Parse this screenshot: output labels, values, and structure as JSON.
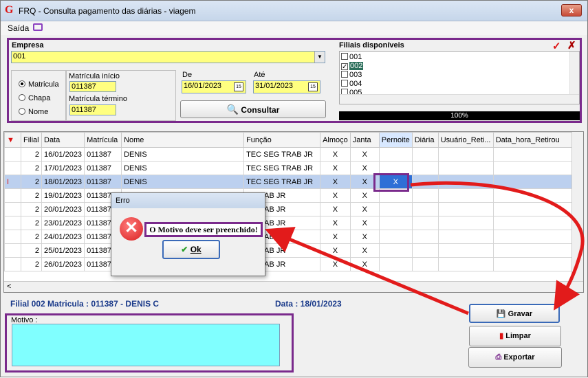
{
  "window": {
    "title": "FRQ - Consulta pagamento das diárias - viagem",
    "close_label": "x"
  },
  "menu": {
    "saida": "Saída"
  },
  "empresa": {
    "label": "Empresa",
    "value": "001"
  },
  "filtro": {
    "opcoes": [
      "Matricula",
      "Chapa",
      "Nome"
    ],
    "selecionada": "Matricula",
    "matricula_inicio_label": "Matrícula início",
    "matricula_inicio": "011387",
    "matricula_termino_label": "Matrícula término",
    "matricula_termino": "011387"
  },
  "periodo": {
    "de_label": "De",
    "de": "16/01/2023",
    "ate_label": "Até",
    "ate": "31/01/2023"
  },
  "consultar_label": "Consultar",
  "filiais": {
    "label": "Filiais disponíveis",
    "items": [
      {
        "code": "001",
        "checked": false
      },
      {
        "code": "002",
        "checked": true
      },
      {
        "code": "003",
        "checked": false
      },
      {
        "code": "004",
        "checked": false
      },
      {
        "code": "005",
        "checked": false
      }
    ],
    "progress": "100%"
  },
  "grid": {
    "columns": [
      "Filial",
      "Data",
      "Matrícula",
      "Nome",
      "Função",
      "Almoço",
      "Janta",
      "Pernoite",
      "Diária",
      "Usuário_Reti...",
      "Data_hora_Retirou"
    ],
    "rows": [
      {
        "filial": "2",
        "data": "16/01/2023",
        "matricula": "011387",
        "nome": "DENIS",
        "funcao": "TEC SEG TRAB JR",
        "almoco": "X",
        "janta": "X",
        "pernoite": ""
      },
      {
        "filial": "2",
        "data": "17/01/2023",
        "matricula": "011387",
        "nome": "DENIS",
        "funcao": "TEC SEG TRAB JR",
        "almoco": "X",
        "janta": "X",
        "pernoite": ""
      },
      {
        "filial": "2",
        "data": "18/01/2023",
        "matricula": "011387",
        "nome": "DENIS",
        "funcao": "TEC SEG TRAB JR",
        "almoco": "X",
        "janta": "X",
        "pernoite": "X"
      },
      {
        "filial": "2",
        "data": "19/01/2023",
        "matricula": "011387",
        "nome": "",
        "funcao": "G TRAB JR",
        "almoco": "X",
        "janta": "X",
        "pernoite": ""
      },
      {
        "filial": "2",
        "data": "20/01/2023",
        "matricula": "011387",
        "nome": "",
        "funcao": "G TRAB JR",
        "almoco": "X",
        "janta": "X",
        "pernoite": ""
      },
      {
        "filial": "2",
        "data": "23/01/2023",
        "matricula": "011387",
        "nome": "",
        "funcao": "G TRAB JR",
        "almoco": "X",
        "janta": "X",
        "pernoite": ""
      },
      {
        "filial": "2",
        "data": "24/01/2023",
        "matricula": "011387",
        "nome": "",
        "funcao": "G TRAB JR",
        "almoco": "X",
        "janta": "X",
        "pernoite": ""
      },
      {
        "filial": "2",
        "data": "25/01/2023",
        "matricula": "011387",
        "nome": "",
        "funcao": "G TRAB JR",
        "almoco": "X",
        "janta": "X",
        "pernoite": ""
      },
      {
        "filial": "2",
        "data": "26/01/2023",
        "matricula": "011387",
        "nome": "",
        "funcao": "G TRAB JR",
        "almoco": "X",
        "janta": "X",
        "pernoite": ""
      }
    ]
  },
  "status": {
    "linha": "Filial 002  Matricula : 011387 - DENIS C",
    "data": "Data : 18/01/2023"
  },
  "motivo": {
    "label": "Motivo :",
    "value": ""
  },
  "buttons": {
    "gravar": "Gravar",
    "limpar": "Limpar",
    "exportar": "Exportar"
  },
  "dialog": {
    "title": "Erro",
    "message": "O Motivo deve ser preenchido!",
    "ok": "Ok"
  },
  "colors": {
    "accent": "#7a2a8c",
    "yellow": "#ffff80",
    "cyan": "#80ffff",
    "arrow": "#e21b1b"
  }
}
